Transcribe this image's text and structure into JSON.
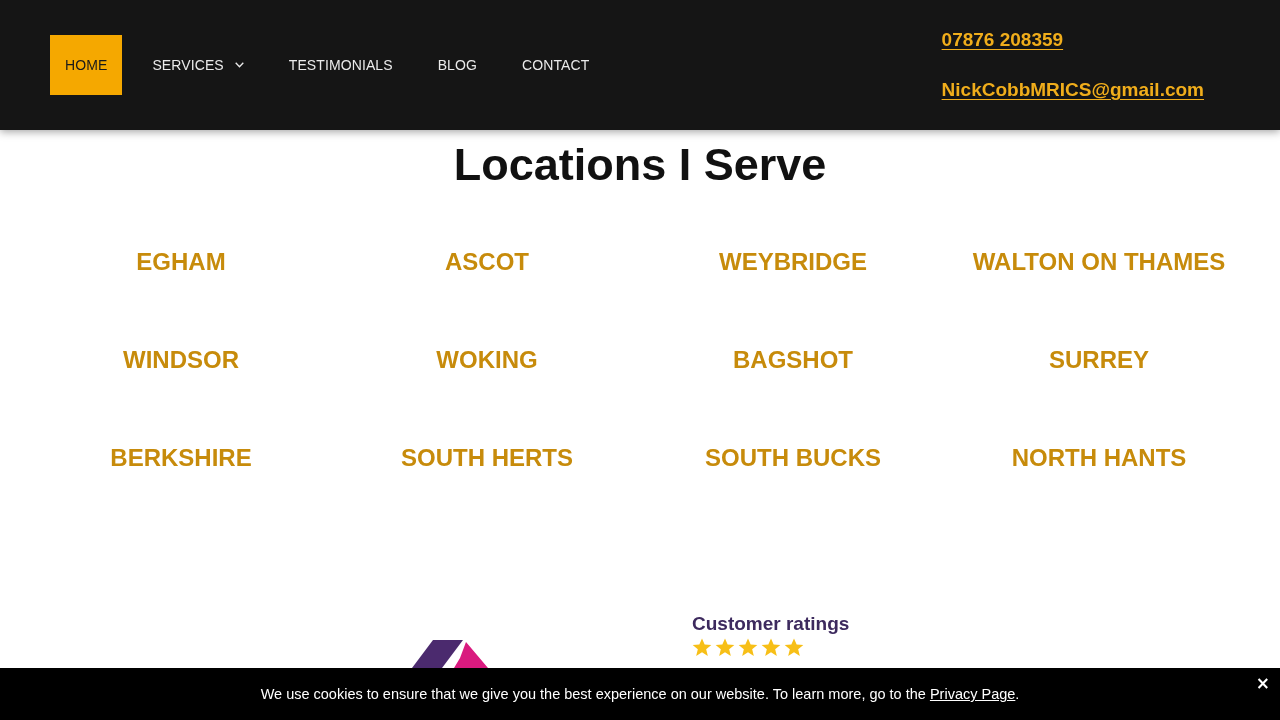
{
  "header": {
    "nav": [
      {
        "label": "HOME",
        "selected": true,
        "dropdown": false
      },
      {
        "label": "SERVICES",
        "selected": false,
        "dropdown": true
      },
      {
        "label": "TESTIMONIALS",
        "selected": false,
        "dropdown": false
      },
      {
        "label": "BLOG",
        "selected": false,
        "dropdown": false
      },
      {
        "label": "CONTACT",
        "selected": false,
        "dropdown": false
      }
    ],
    "phone": "07876 208359",
    "email": "NickCobbMRICS@gmail.com"
  },
  "locations": {
    "title": "Locations I Serve",
    "items": [
      "EGHAM",
      "ASCOT",
      "WEYBRIDGE",
      "WALTON ON THAMES",
      "WINDSOR",
      "WOKING",
      "BAGSHOT",
      "SURREY",
      "BERKSHIRE",
      "SOUTH HERTS",
      "SOUTH BUCKS",
      "NORTH HANTS"
    ]
  },
  "ratings": {
    "title": "Customer ratings",
    "stars": 5
  },
  "cookie_bar": {
    "message": "We use cookies to ensure that we give you the best experience on our website. To learn more, go to the",
    "link": "Privacy Page",
    "message_end": ".",
    "close": "×"
  }
}
